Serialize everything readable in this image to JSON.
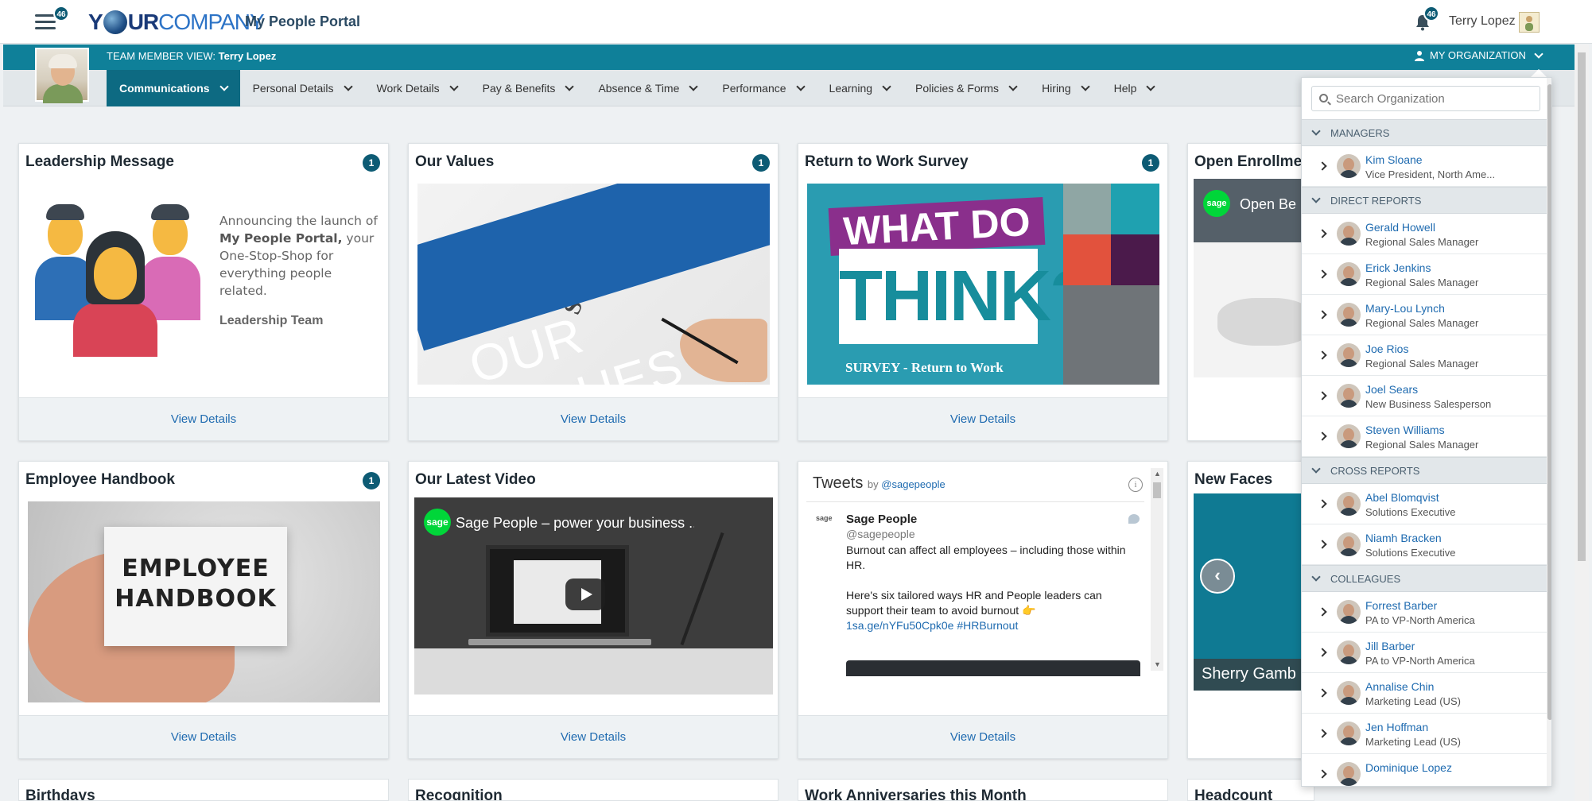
{
  "header": {
    "menu_badge": "46",
    "logo_y": "Y",
    "logo_ur": "UR",
    "logo_company": "COMPANY",
    "portal_title": "My People Portal",
    "notifications_badge": "46",
    "user_name": "Terry Lopez"
  },
  "team_bar": {
    "view_label": "TEAM MEMBER VIEW:",
    "view_user": "Terry Lopez",
    "my_org_label": "MY ORGANIZATION"
  },
  "nav": {
    "items": [
      {
        "label": "Communications",
        "active": true
      },
      {
        "label": "Personal Details"
      },
      {
        "label": "Work Details"
      },
      {
        "label": "Pay & Benefits"
      },
      {
        "label": "Absence & Time"
      },
      {
        "label": "Performance"
      },
      {
        "label": "Learning"
      },
      {
        "label": "Policies & Forms"
      },
      {
        "label": "Hiring"
      },
      {
        "label": "Help"
      }
    ]
  },
  "cards": {
    "leadership": {
      "title": "Leadership Message",
      "badge": "1",
      "text_a": "Announcing the launch of ",
      "text_bold": "My People Portal,",
      "text_b": " your One-Stop-Shop for everything people related.",
      "signature": "Leadership Team",
      "link": "View Details"
    },
    "values": {
      "title": "Our Values",
      "badge": "1",
      "image_text": "OUR VALUES",
      "link": "View Details"
    },
    "survey": {
      "title": "Return to Work Survey",
      "badge": "1",
      "image_line1": "WHAT DO YOU",
      "image_line2": "THINK?",
      "image_sub": "SURVEY - Return to Work",
      "link": "View Details"
    },
    "enrollment": {
      "title": "Open Enrollme",
      "image_text": "Open Be"
    },
    "handbook": {
      "title": "Employee Handbook",
      "badge": "1",
      "image_line1": "EMPLOYEE",
      "image_line2": "HANDBOOK",
      "link": "View Details"
    },
    "video": {
      "title": "Our Latest Video",
      "video_title": "Sage People – power your business ...",
      "sage_logo": "sage",
      "link": "View Details"
    },
    "tweets": {
      "heading": "Tweets",
      "by": "by",
      "by_handle": "@sagepeople",
      "tweet_name": "Sage People",
      "tweet_handle": "@sagepeople",
      "tweet_line1": "Burnout can affect all employees – including those within HR.",
      "tweet_line2": "Here's six tailored ways HR and People leaders can support their team to avoid burnout 👉",
      "tweet_link": "1sa.ge/nYFu50Cpk0e #HRBurnout",
      "link": "View Details"
    },
    "new_faces": {
      "title": "New Faces",
      "caption": "Sherry Gamb"
    },
    "bottom_row": [
      "Birthdays",
      "Recognition",
      "Work Anniversaries this Month",
      "Headcount"
    ]
  },
  "org_panel": {
    "search_placeholder": "Search Organization",
    "sections": [
      {
        "name": "MANAGERS",
        "people": [
          {
            "name": "Kim Sloane",
            "role": "Vice President, North Ame..."
          }
        ]
      },
      {
        "name": "DIRECT REPORTS",
        "people": [
          {
            "name": "Gerald Howell",
            "role": "Regional Sales Manager"
          },
          {
            "name": "Erick Jenkins",
            "role": "Regional Sales Manager"
          },
          {
            "name": "Mary-Lou Lynch",
            "role": "Regional Sales Manager"
          },
          {
            "name": "Joe Rios",
            "role": "Regional Sales Manager"
          },
          {
            "name": "Joel Sears",
            "role": "New Business Salesperson"
          },
          {
            "name": "Steven Williams",
            "role": "Regional Sales Manager"
          }
        ]
      },
      {
        "name": "CROSS REPORTS",
        "people": [
          {
            "name": "Abel Blomqvist",
            "role": "Solutions Executive"
          },
          {
            "name": "Niamh Bracken",
            "role": "Solutions Executive"
          }
        ]
      },
      {
        "name": "COLLEAGUES",
        "people": [
          {
            "name": "Forrest Barber",
            "role": "PA to VP-North America"
          },
          {
            "name": "Jill Barber",
            "role": "PA to VP-North America"
          },
          {
            "name": "Annalise Chin",
            "role": "Marketing Lead (US)"
          },
          {
            "name": "Jen Hoffman",
            "role": "Marketing Lead (US)"
          },
          {
            "name": "Dominique Lopez",
            "role": ""
          }
        ]
      }
    ]
  },
  "colors": {
    "teal": "#0f8099",
    "nav_active": "#0d6a82",
    "badge": "#0d5b74",
    "link": "#1f6bb0"
  }
}
